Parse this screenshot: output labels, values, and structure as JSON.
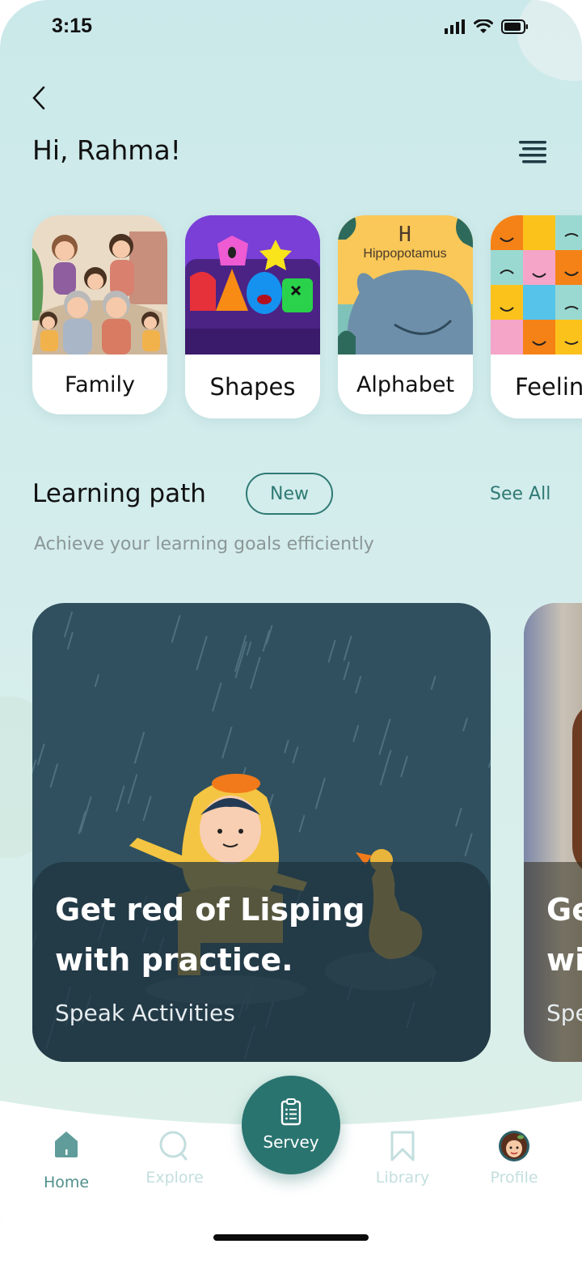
{
  "status_bar": {
    "time": "3:15",
    "icons": [
      "signal-icon",
      "wifi-icon",
      "battery-icon"
    ]
  },
  "header": {
    "back_icon": "chevron-left-icon",
    "greeting": "Hi, Rahma!",
    "menu_icon": "menu-icon"
  },
  "categories": [
    {
      "label": "Family",
      "image": "family-illustration"
    },
    {
      "label": "Shapes",
      "image": "shapes-illustration"
    },
    {
      "label": "Alphabet",
      "image": "alphabet-illustration",
      "image_text": "Hippopotamus",
      "image_letter": "H"
    },
    {
      "label": "Feelin",
      "image": "feelings-illustration"
    }
  ],
  "learning_path": {
    "title": "Learning path",
    "badge": "New",
    "see_all": "See All",
    "subtitle": "Achieve your learning goals efficiently"
  },
  "cards": [
    {
      "title": "Get red of Lisping with practice.",
      "subtitle": "Speak Activities",
      "image": "rain-child-duck-illustration"
    },
    {
      "title_partial_1": "Ge",
      "title_partial_2": "wi",
      "subtitle_partial": "Spe",
      "image": "girl-window-illustration"
    }
  ],
  "tab_bar": {
    "items": [
      {
        "label": "Home",
        "icon": "home-icon",
        "active": true
      },
      {
        "label": "Explore",
        "icon": "search-icon",
        "active": false
      },
      {
        "label": "Servey",
        "icon": "clipboard-icon",
        "active": false
      },
      {
        "label": "Library",
        "icon": "bookmark-icon",
        "active": false
      },
      {
        "label": "Profile",
        "icon": "avatar",
        "active": false
      }
    ]
  },
  "colors": {
    "accent": "#2a7470",
    "inactive": "#c3dede",
    "card_bg": "#30505f"
  }
}
